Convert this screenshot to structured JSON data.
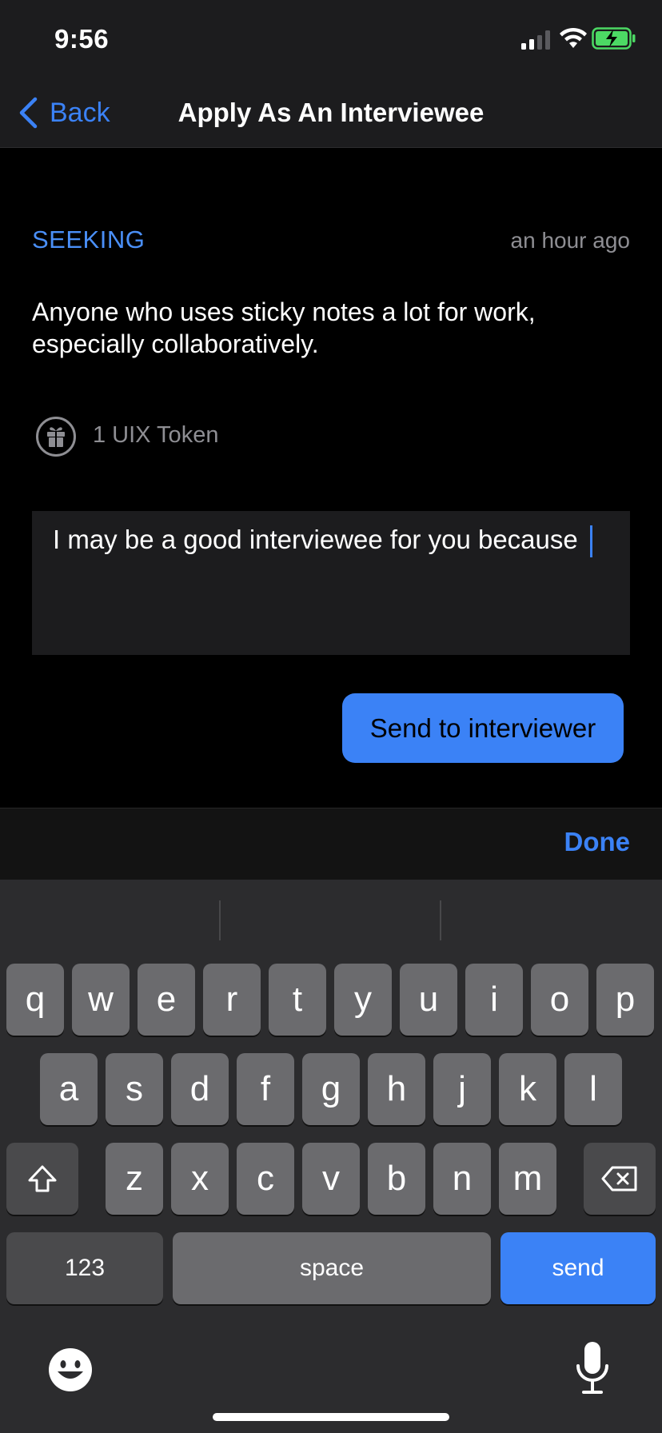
{
  "status_bar": {
    "time": "9:56"
  },
  "nav": {
    "back_label": "Back",
    "title": "Apply As An Interviewee"
  },
  "request": {
    "tag": "SEEKING",
    "time_ago": "an hour ago",
    "description": "Anyone who uses sticky notes a lot for work, especially collaboratively.",
    "reward": "1 UIX Token"
  },
  "message": {
    "value": "I may be a good interviewee for you because "
  },
  "send_button": "Send to interviewer",
  "toolbar": {
    "done_label": "Done"
  },
  "keyboard": {
    "row1": [
      "q",
      "w",
      "e",
      "r",
      "t",
      "y",
      "u",
      "i",
      "o",
      "p"
    ],
    "row2": [
      "a",
      "s",
      "d",
      "f",
      "g",
      "h",
      "j",
      "k",
      "l"
    ],
    "row3": [
      "z",
      "x",
      "c",
      "v",
      "b",
      "n",
      "m"
    ],
    "numbers_label": "123",
    "space_label": "space",
    "send_label": "send"
  },
  "colors": {
    "accent": "#3b82f6",
    "background": "#000000",
    "secondary_text": "#8e8e93",
    "key": "#6b6b6e",
    "key_dark": "#4a4a4c",
    "keyboard_bg": "#2c2c2e"
  },
  "icons": {
    "back": "chevron-left-icon",
    "reward": "gift-icon",
    "shift": "shift-arrow-icon",
    "delete": "backspace-icon",
    "emoji": "emoji-face-icon",
    "mic": "microphone-icon"
  }
}
